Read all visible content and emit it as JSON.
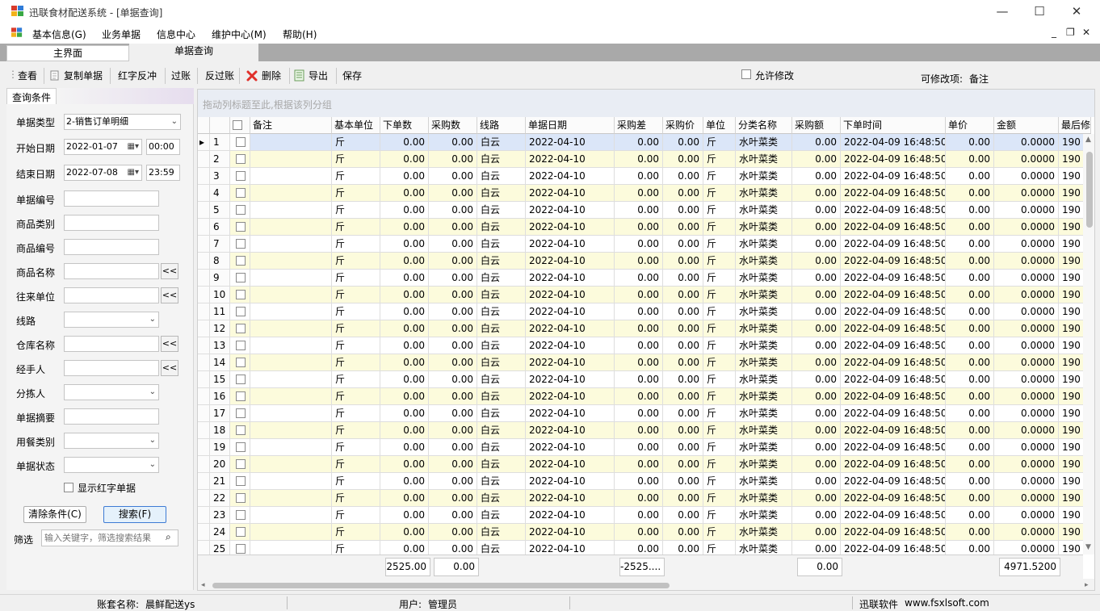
{
  "window": {
    "title": "迅联食材配送系统 - [单据查询]",
    "minimize": "—",
    "maximize": "☐",
    "close": "✕"
  },
  "menu": {
    "items": [
      "基本信息(G)",
      "业务单据",
      "信息中心",
      "维护中心(M)",
      "帮助(H)"
    ],
    "mdi_controls": [
      "_",
      "❐",
      "✕"
    ]
  },
  "tabs": [
    "主界面",
    "单据查询"
  ],
  "toolbar": {
    "view": "查看",
    "copy": "复制单据",
    "red_reverse": "红字反冲",
    "post": "过账",
    "unpost": "反过账",
    "delete": "删除",
    "export": "导出",
    "save": "保存",
    "allow_edit": "允许修改",
    "editable_label": "可修改项:",
    "editable_value": "备注"
  },
  "filters": {
    "panel_title": "查询条件",
    "doc_type_label": "单据类型",
    "doc_type_value": "2-销售订单明细",
    "start_label": "开始日期",
    "start_date": "2022-01-07",
    "start_time": "00:00",
    "end_label": "结束日期",
    "end_date": "2022-07-08",
    "end_time": "23:59",
    "doc_no_label": "单据编号",
    "category_label": "商品类别",
    "product_code_label": "商品编号",
    "product_name_label": "商品名称",
    "partner_label": "往来单位",
    "route_label": "线路",
    "warehouse_label": "仓库名称",
    "handler_label": "经手人",
    "sorter_label": "分拣人",
    "summary_label": "单据摘要",
    "meal_label": "用餐类别",
    "status_label": "单据状态",
    "show_red": "显示红字单据",
    "pick": "<<",
    "clear_btn": "清除条件(C)",
    "search_btn": "搜索(F)",
    "filter_label": "筛选",
    "filter_placeholder": "输入关键字，筛选搜索结果"
  },
  "grid": {
    "group_hint": "拖动列标题至此,根据该列分组",
    "columns": [
      "备注",
      "基本单位",
      "下单数",
      "采购数",
      "线路",
      "单据日期",
      "采购差",
      "采购价",
      "单位",
      "分类名称",
      "采购额",
      "下单时间",
      "单价",
      "金额",
      "最后修"
    ],
    "row_template": {
      "note": "",
      "base_unit": "斤",
      "order_qty": "0.00",
      "purchase_qty": "0.00",
      "route": "白云",
      "doc_date": "2022-04-10",
      "purchase_diff": "0.00",
      "purchase_price": "0.00",
      "unit": "斤",
      "category": "水叶菜类",
      "purchase_amount": "0.00",
      "order_time": "2022-04-09 16:48:50",
      "unit_price": "0.00",
      "amount": "0.0000",
      "last_modified": "190"
    },
    "row_numbers": [
      "1",
      "2",
      "3",
      "4",
      "5",
      "6",
      "7",
      "8",
      "9",
      "10",
      "11",
      "12",
      "13",
      "14",
      "15",
      "16",
      "17",
      "18",
      "19",
      "20",
      "21",
      "22",
      "23",
      "24",
      "25"
    ],
    "current_row_marker": "▸",
    "totals": {
      "order_qty": "2525.00",
      "purchase_qty": "0.00",
      "purchase_diff": "-2525....",
      "purchase_amount": "0.00",
      "amount": "4971.5200"
    }
  },
  "statusbar": {
    "account_label": "账套名称:",
    "account_value": "晨鲜配送ys",
    "user_label": "用户:",
    "user_value": "管理员",
    "vendor": "迅联软件",
    "site": "www.fsxlsoft.com"
  },
  "colors": {
    "row_odd": "#ffffff",
    "row_even": "#fcfbdc",
    "row_selected": "#dbe6f8",
    "group_panel": "#e9edf4"
  }
}
